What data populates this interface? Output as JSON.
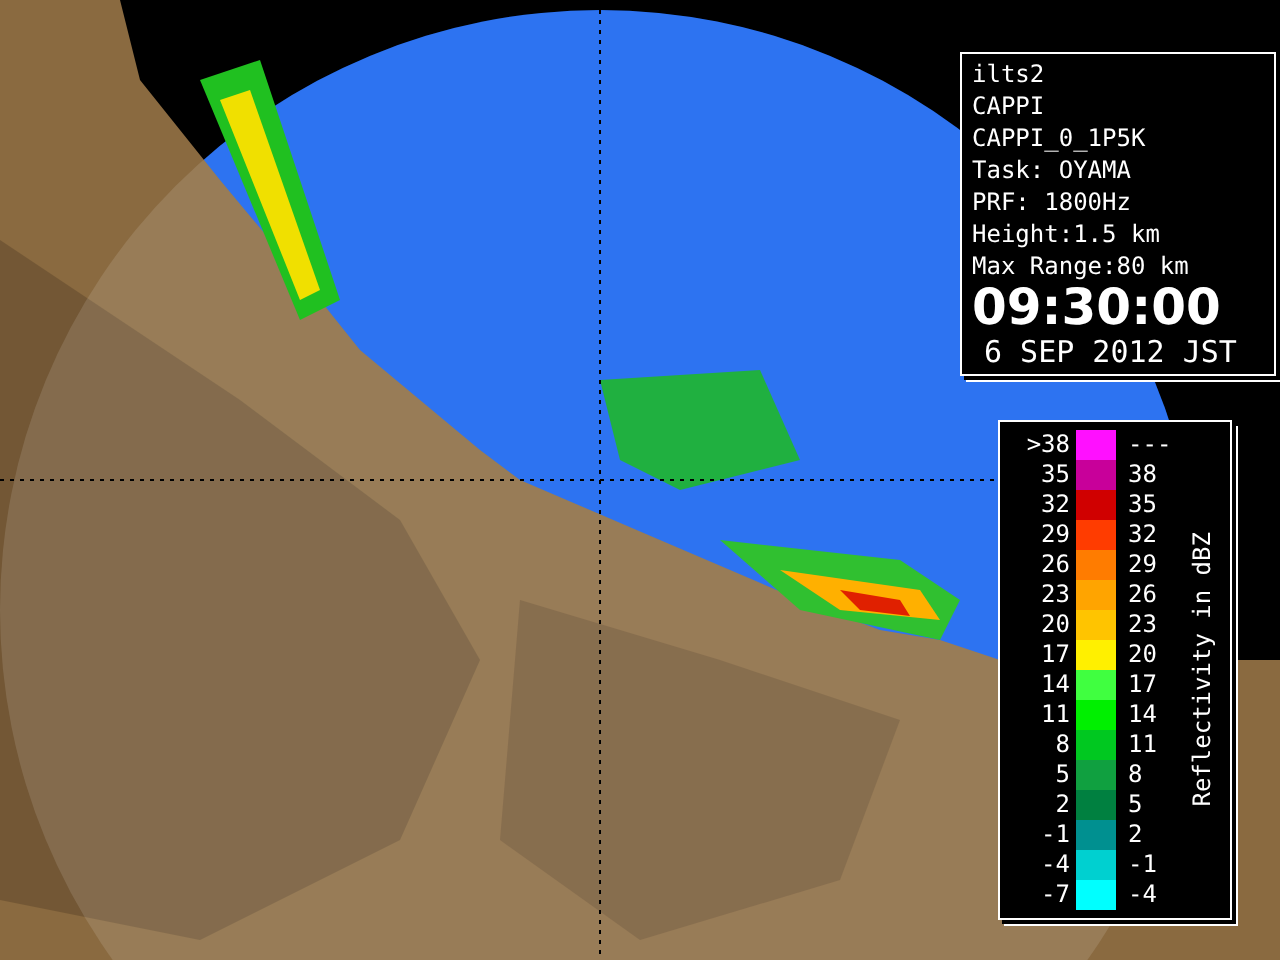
{
  "info": {
    "lines": [
      "ilts2",
      "CAPPI",
      "CAPPI_0_1P5K",
      "Task: OYAMA",
      "PRF: 1800Hz",
      "Height:1.5 km",
      "Max Range:80 km"
    ],
    "time": "09:30:00",
    "date": "6 SEP 2012 JST"
  },
  "legend": {
    "title": "Reflectivity in dBZ",
    "rows": [
      {
        "low": ">38",
        "high": "---",
        "color": "#ff10ff"
      },
      {
        "low": "35",
        "high": "38",
        "color": "#c8009a"
      },
      {
        "low": "32",
        "high": "35",
        "color": "#d00000"
      },
      {
        "low": "29",
        "high": "32",
        "color": "#ff3c00"
      },
      {
        "low": "26",
        "high": "29",
        "color": "#ff7c00"
      },
      {
        "low": "23",
        "high": "26",
        "color": "#ffa400"
      },
      {
        "low": "20",
        "high": "23",
        "color": "#ffc400"
      },
      {
        "low": "17",
        "high": "20",
        "color": "#fff000"
      },
      {
        "low": "14",
        "high": "17",
        "color": "#40ff40"
      },
      {
        "low": "11",
        "high": "14",
        "color": "#00f000"
      },
      {
        "low": "8",
        "high": "11",
        "color": "#00c820"
      },
      {
        "low": "5",
        "high": "8",
        "color": "#10a040"
      },
      {
        "low": "2",
        "high": "5",
        "color": "#008040"
      },
      {
        "low": "-1",
        "high": "2",
        "color": "#009090"
      },
      {
        "low": "-4",
        "high": "-1",
        "color": "#00d0d0"
      },
      {
        "low": "-7",
        "high": "-4",
        "color": "#00ffff"
      }
    ]
  }
}
